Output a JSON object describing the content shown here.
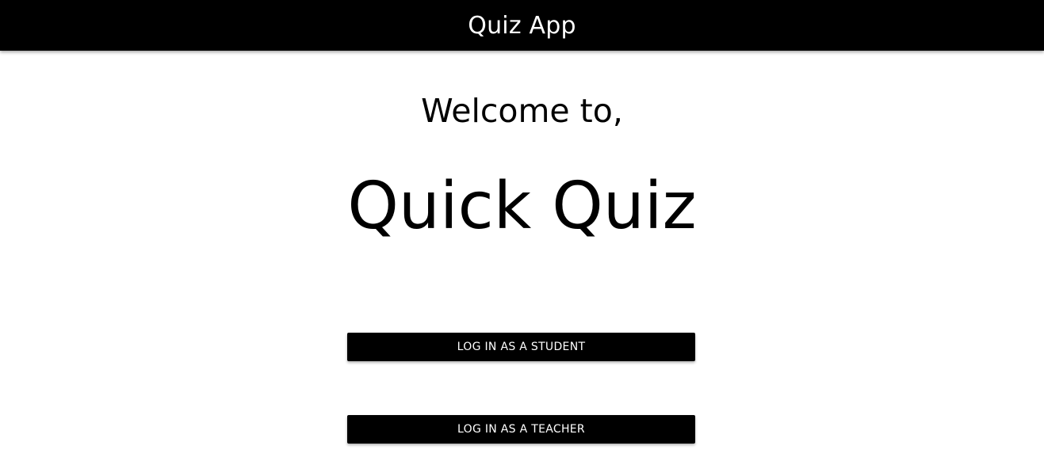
{
  "header": {
    "title": "Quiz App"
  },
  "main": {
    "welcome_text": "Welcome to,",
    "brand_name": "Quick Quiz",
    "buttons": {
      "student_label": "LOG IN AS A STUDENT",
      "teacher_label": "LOG IN AS A TEACHER"
    }
  },
  "colors": {
    "header_bg": "#000000",
    "button_bg": "#000000",
    "button_text": "#ffffff",
    "page_bg": "#ffffff"
  }
}
